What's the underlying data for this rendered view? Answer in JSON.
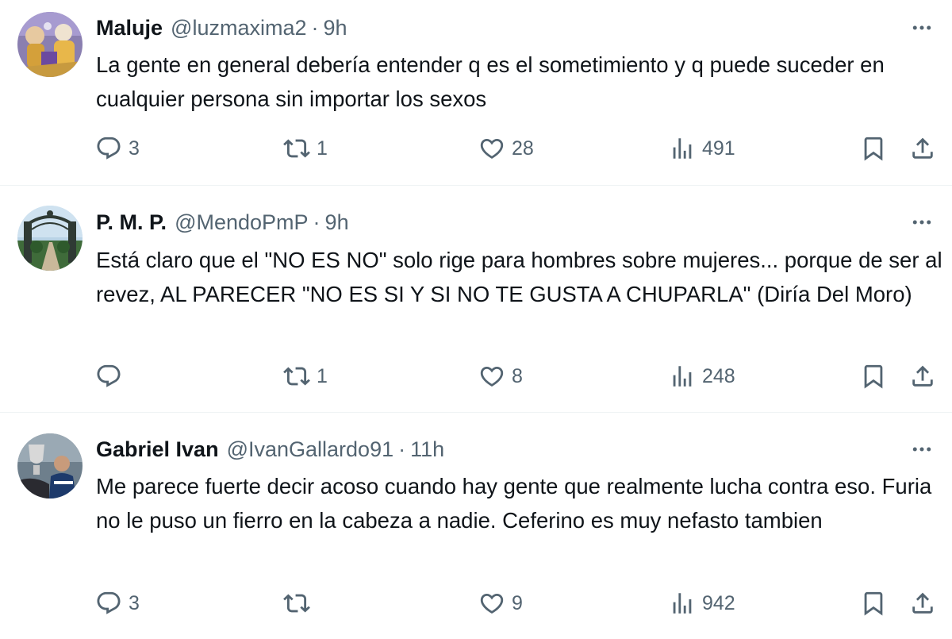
{
  "tweets": [
    {
      "name": "Maluje",
      "handle": "@luzmaxima2",
      "separator": "·",
      "time": "9h",
      "text": "La gente en general debería entender q es el sometimiento y q puede suceder en cualquier persona sin importar los sexos",
      "replies": "3",
      "retweets": "1",
      "likes": "28",
      "views": "491",
      "avatar_icon": "colorful-figures-avatar"
    },
    {
      "name": "P. M. P.",
      "handle": "@MendoPmP",
      "separator": "·",
      "time": "9h",
      "text": "Está claro que el \"NO ES NO\" solo rige para hombres sobre mujeres... porque de ser al revez, AL PARECER \"NO ES SI Y SI NO TE GUSTA A CHUPARLA\" (Diría Del Moro)",
      "replies": "",
      "retweets": "1",
      "likes": "8",
      "views": "248",
      "avatar_icon": "park-gate-avatar"
    },
    {
      "name": "Gabriel Ivan",
      "handle": "@IvanGallardo91",
      "separator": "·",
      "time": "11h",
      "text": "Me parece fuerte decir acoso cuando hay gente que realmente lucha contra eso. Furia no le puso un fierro en la cabeza a nadie. Ceferino es muy nefasto tambien",
      "replies": "3",
      "retweets": "",
      "likes": "9",
      "views": "942",
      "avatar_icon": "trophy-player-avatar"
    }
  ],
  "icons": {
    "reply": "reply-icon",
    "retweet": "retweet-icon",
    "like": "heart-icon",
    "views": "views-icon",
    "bookmark": "bookmark-icon",
    "share": "share-icon",
    "more": "more-icon"
  },
  "colors": {
    "text": "#0f1419",
    "secondary": "#536471",
    "divider": "#eff3f4"
  }
}
